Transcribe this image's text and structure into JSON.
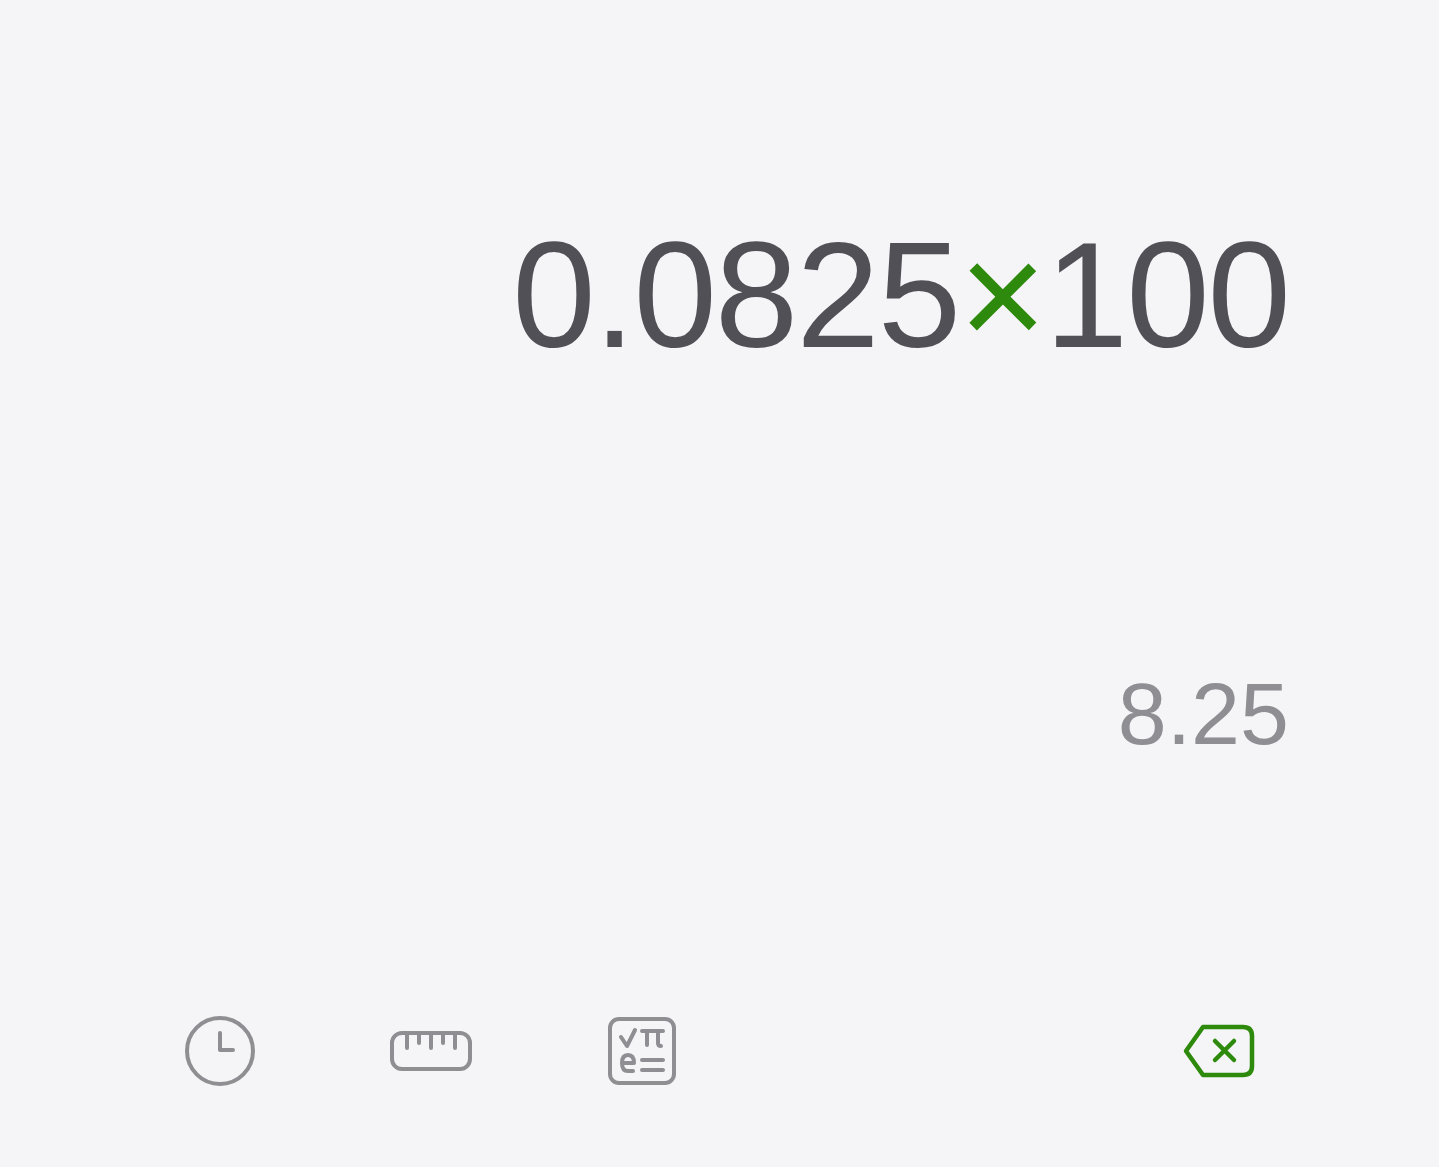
{
  "expression": [
    {
      "text": "0.0825",
      "kind": "number"
    },
    {
      "text": "×",
      "kind": "operator"
    },
    {
      "text": "100",
      "kind": "number"
    }
  ],
  "result": "8.25",
  "toolbar": [
    {
      "kind": "history"
    },
    {
      "kind": "unit-converter"
    },
    {
      "kind": "scientific"
    },
    {
      "kind": "backspace"
    }
  ]
}
